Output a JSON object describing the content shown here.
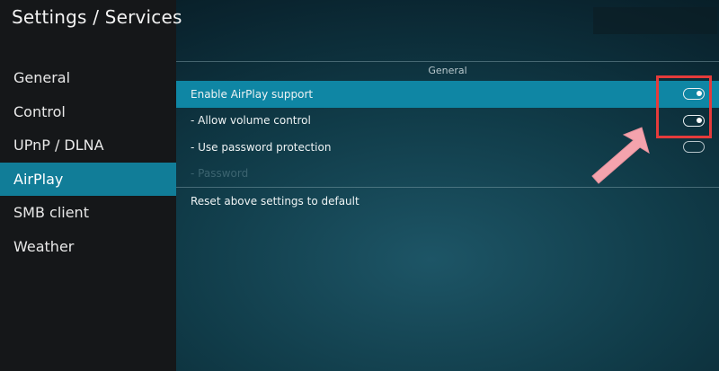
{
  "header": {
    "title": "Settings / Services"
  },
  "sidebar": {
    "items": [
      {
        "label": "General"
      },
      {
        "label": "Control"
      },
      {
        "label": "UPnP / DLNA"
      },
      {
        "label": "AirPlay"
      },
      {
        "label": "SMB client"
      },
      {
        "label": "Weather"
      }
    ],
    "active": "AirPlay"
  },
  "main": {
    "group_header": "General",
    "settings": [
      {
        "label": "Enable AirPlay support",
        "toggle": "on"
      },
      {
        "label": "- Allow volume control",
        "toggle": "on"
      },
      {
        "label": "- Use password protection",
        "toggle": "off"
      },
      {
        "label": "- Password"
      }
    ],
    "reset_label": "Reset above settings to default"
  },
  "colors": {
    "accent": "#117d98",
    "focused_row": "#0f86a4",
    "highlight_box": "#e53b3b",
    "arrow": "#f4a3ad"
  },
  "icons": {
    "toggle": "toggle-switch-icon",
    "pointer": "arrow-annotation-icon"
  }
}
